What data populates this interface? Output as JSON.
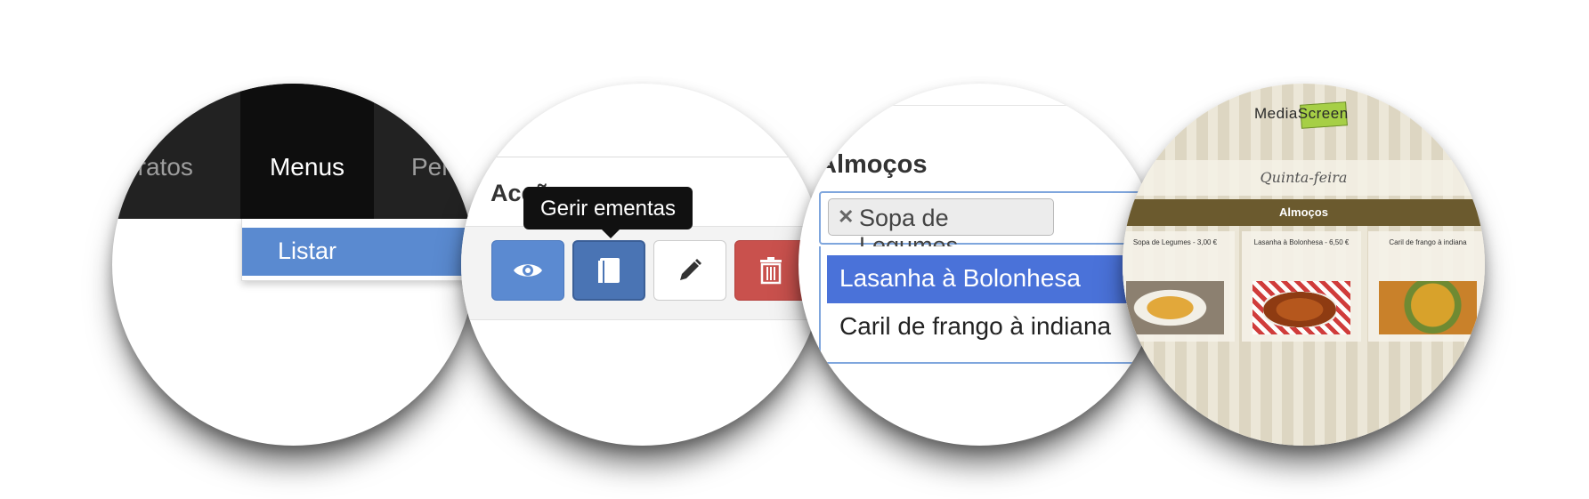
{
  "nav": {
    "items": [
      "Pratos",
      "Menus",
      "Pen"
    ],
    "active": "Menus",
    "dropdown_active": "Listar"
  },
  "actions": {
    "section_title": "Acções",
    "tooltip": "Gerir ementas",
    "buttons": [
      {
        "name": "view",
        "icon": "eye-icon",
        "color": "#5b8ad1"
      },
      {
        "name": "manage-menus",
        "icon": "book-icon",
        "color": "#4a74b4"
      },
      {
        "name": "edit",
        "icon": "pencil-icon",
        "color": "#ffffff"
      },
      {
        "name": "delete",
        "icon": "trash-icon",
        "color": "#c9514d"
      }
    ]
  },
  "select": {
    "label": "Almoços",
    "selected_chip": "Sopa de Legumes",
    "options": [
      "Lasanha à Bolonhesa",
      "Caril de frango à indiana"
    ],
    "highlighted": "Lasanha à Bolonhesa",
    "highlight_color": "#4a72d9"
  },
  "screen": {
    "logo": "MediaScreen",
    "day": "Quinta-feira",
    "section": "Almoços",
    "cards": [
      {
        "label": "Sopa de Legumes - 3,00 €"
      },
      {
        "label": "Lasanha à Bolonhesa - 6,50 €"
      },
      {
        "label": "Caril de frango à indiana"
      }
    ]
  }
}
